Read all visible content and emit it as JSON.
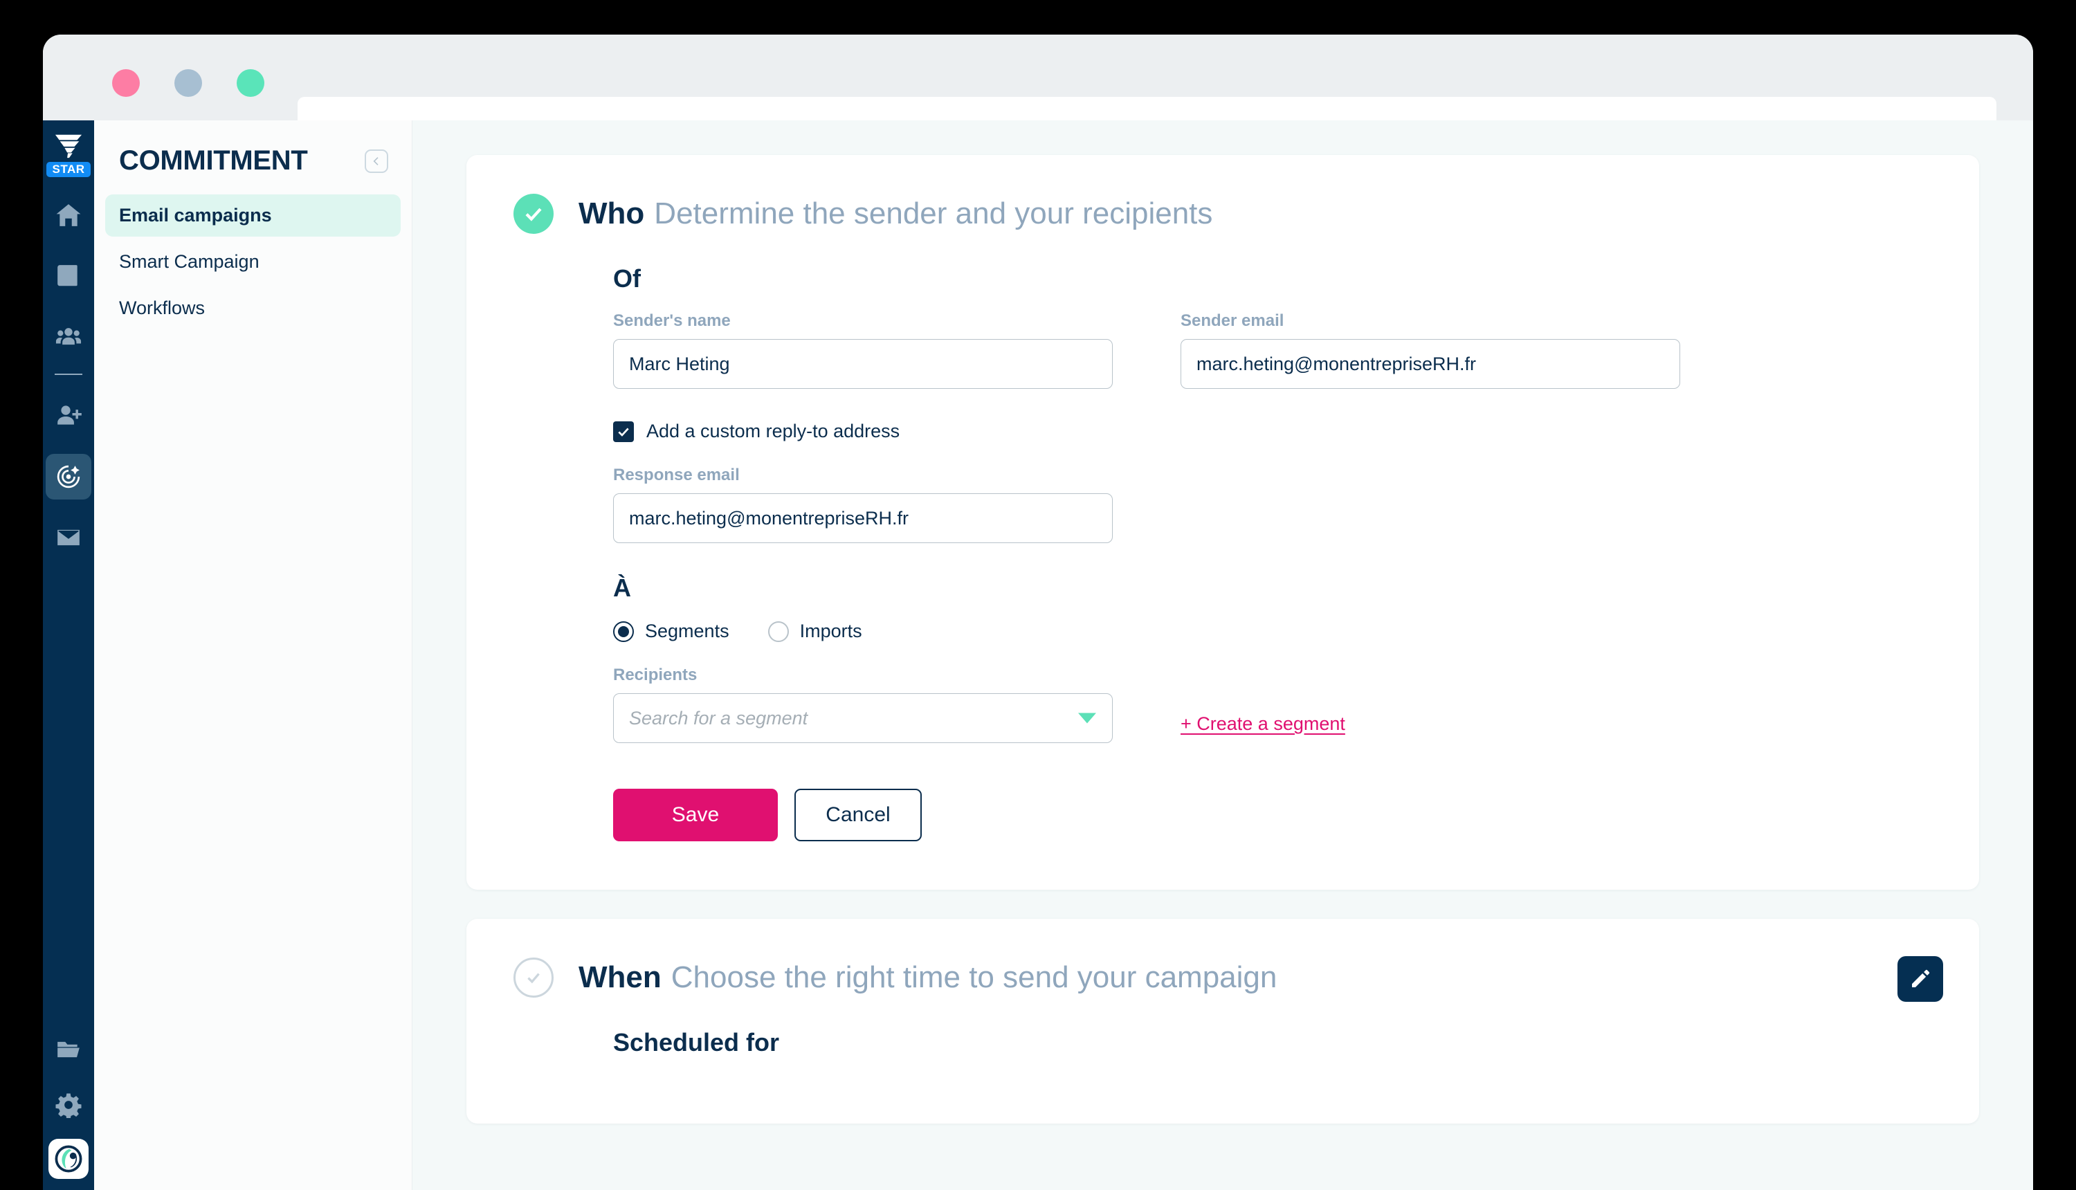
{
  "browser": {
    "traffic_lights": [
      "close-red",
      "minimize-amber",
      "maximize-green"
    ],
    "url_value": "",
    "url_placeholder": ""
  },
  "rail": {
    "brand_logo": "tornado-logo",
    "plan_badge": "STAR",
    "items": [
      {
        "icon": "home-icon",
        "active": false
      },
      {
        "icon": "book-icon",
        "active": false
      },
      {
        "icon": "users-group-icon",
        "active": false
      },
      {
        "icon": "user-plus-icon",
        "active": false
      },
      {
        "icon": "target-icon",
        "active": true
      },
      {
        "icon": "envelope-icon",
        "active": false
      }
    ],
    "bottom_items": [
      {
        "icon": "folder-icon"
      },
      {
        "icon": "gear-icon"
      }
    ],
    "avatar": "account-avatar-logo"
  },
  "sidebar": {
    "title": "COMMITMENT",
    "collapse_icon": "chevron-left-icon",
    "items": [
      {
        "label": "Email campaigns",
        "active": true
      },
      {
        "label": "Smart Campaign",
        "active": false
      },
      {
        "label": "Workflows",
        "active": false
      }
    ]
  },
  "who_section": {
    "status_icon": "check-circle-filled-icon",
    "title": "Who",
    "subtitle": "Determine the sender and your recipients",
    "of_label": "Of",
    "sender_name": {
      "label": "Sender's name",
      "value": "Marc Heting",
      "placeholder": ""
    },
    "sender_email": {
      "label": "Sender email",
      "value": "marc.heting@monentrepriseRH.fr",
      "placeholder": ""
    },
    "reply_to_checkbox": {
      "label": "Add a custom reply-to address",
      "checked": true,
      "icon": "checkmark-icon"
    },
    "response_email": {
      "label": "Response email",
      "value": "marc.heting@monentrepriseRH.fr",
      "placeholder": ""
    },
    "to_label": "À",
    "audience_options": [
      {
        "label": "Segments",
        "selected": true
      },
      {
        "label": "Imports",
        "selected": false
      }
    ],
    "recipients": {
      "label": "Recipients",
      "value": "",
      "placeholder": "Search for a segment",
      "caret_icon": "chevron-down-icon"
    },
    "create_segment_link": "+ Create a segment",
    "save_label": "Save",
    "cancel_label": "Cancel"
  },
  "when_section": {
    "status_icon": "check-circle-outline-icon",
    "title": "When",
    "subtitle": "Choose the right time to send your campaign",
    "scheduled_label": "Scheduled for",
    "edit_icon": "pencil-icon"
  },
  "colors": {
    "brand_navy": "#052f52",
    "text_navy": "#0b2d4d",
    "accent_pink": "#e01070",
    "accent_mint": "#5ce0b7",
    "muted_blue": "#8fa6bc",
    "badge_blue": "#128cf5",
    "nav_active_bg": "#def6f0",
    "page_bg": "#f4f9f9"
  }
}
